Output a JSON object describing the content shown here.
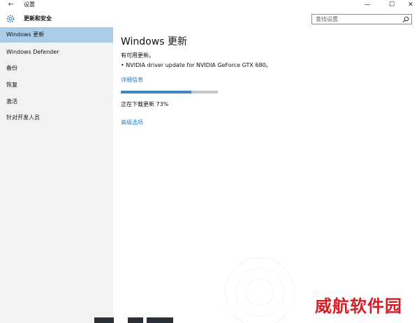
{
  "window": {
    "back_glyph": "←",
    "title": "设置",
    "minimize_glyph": "—",
    "maximize_glyph": "☐",
    "close_glyph": "✕"
  },
  "header": {
    "title": "更新和安全",
    "search_placeholder": "查找设置",
    "icons": [
      "gear-icon",
      "search-icon"
    ]
  },
  "sidebar": {
    "items": [
      {
        "label": "Windows 更新",
        "active": true
      },
      {
        "label": "Windows Defender",
        "active": false
      },
      {
        "label": "备份",
        "active": false
      },
      {
        "label": "恢复",
        "active": false
      },
      {
        "label": "激活",
        "active": false
      },
      {
        "label": "针对开发人员",
        "active": false
      }
    ]
  },
  "main": {
    "heading": "Windows 更新",
    "available_text": "有可用更新。",
    "update_item": "• NVIDIA driver update for NVIDIA GeForce GTX 680。",
    "details_link": "详细信息",
    "progress_fraction": 0.73,
    "status_text": "正在下载更新 73%",
    "advanced_link": "高级选项"
  },
  "watermark": {
    "text": "威航软件园"
  },
  "colors": {
    "sidebar_bg": "#f2f2f2",
    "active_item_bg": "#a9cde8",
    "link": "#2b78b8",
    "progress_fill": "#3b87c3",
    "progress_track": "#c6c6c6",
    "watermark": "#d51d24"
  }
}
